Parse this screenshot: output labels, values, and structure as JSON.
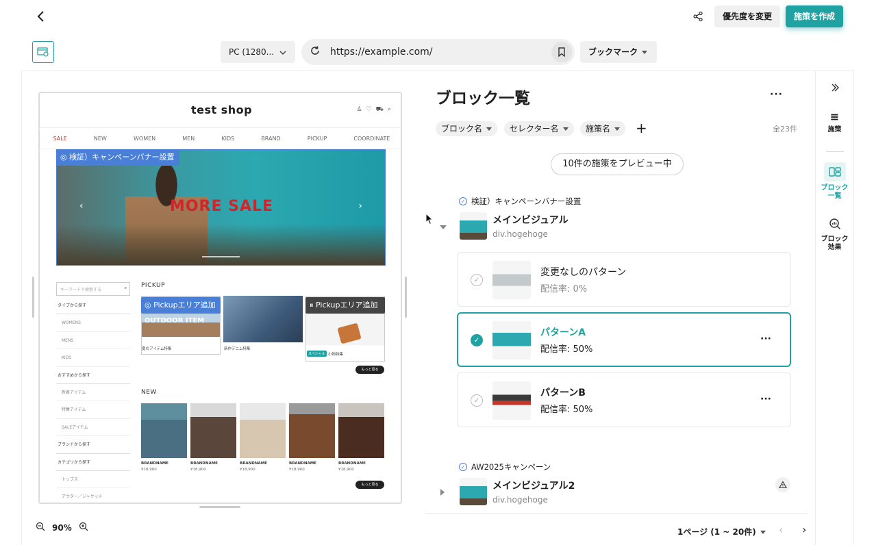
{
  "header": {
    "priority_button": "優先度を変更",
    "create_button": "施策を作成"
  },
  "toolbar": {
    "device": "PC (1280...",
    "url": "https://example.com/",
    "bookmark": "ブックマーク"
  },
  "preview": {
    "shop_title": "test shop",
    "nav": [
      "SALE",
      "NEW",
      "WOMEN",
      "MEN",
      "KIDS",
      "BRAND",
      "PICKUP",
      "COORDINATE"
    ],
    "hero_badge": "検証）キャンペーンバナー設置",
    "hero_text": "MORE SALE",
    "side_search_placeholder": "キーワードで検索する",
    "side_rows": [
      {
        "label": "タイプから探す",
        "sub": false
      },
      {
        "label": "WOMENS",
        "sub": true
      },
      {
        "label": "MENS",
        "sub": true
      },
      {
        "label": "KIDS",
        "sub": true
      },
      {
        "label": "おすすめから探す",
        "sub": false
      },
      {
        "label": "新着アイテム",
        "sub": true
      },
      {
        "label": "特集アイテム",
        "sub": true
      },
      {
        "label": "SALEアイテム",
        "sub": true
      },
      {
        "label": "ブランドから探す",
        "sub": false
      },
      {
        "label": "カテゴリから探す",
        "sub": false
      },
      {
        "label": "トップス",
        "sub": true
      },
      {
        "label": "アウター／ジャケット",
        "sub": true
      }
    ],
    "pickup_label": "PICKUP",
    "pickup_badge_1": "Pickupエリア追加",
    "pickup_badge_2": "Pickupエリア追加",
    "outdoor_text": "OUTDOOR ITEM",
    "pickup_caps": [
      "夏のアイテム特集",
      "新作デニム特集",
      "小物特集"
    ],
    "special_tag": "スペシャル",
    "more_label": "もっと見る",
    "new_label": "NEW",
    "products": [
      {
        "name": "BRANDNAME",
        "price": "¥18,900"
      },
      {
        "name": "BRANDNAME",
        "price": "¥18,900"
      },
      {
        "name": "BRANDNAME",
        "price": "¥18,900"
      },
      {
        "name": "BRANDNAME",
        "price": "¥18,900"
      },
      {
        "name": "BRANDNAME",
        "price": "¥18,900"
      }
    ],
    "zoom": "90%"
  },
  "panel": {
    "title": "ブロック一覧",
    "filters": [
      "ブロック名",
      "セレクター名",
      "施策名"
    ],
    "total": "全23件",
    "preview_pill": "10件の施策をプレビュー中",
    "block1": {
      "campaign": "検証）キャンペーンバナー設置",
      "title": "メインビジュアル",
      "selector": "div.hogehoge",
      "patterns": [
        {
          "name": "変更なしのパターン",
          "rate": "配信率: 0%"
        },
        {
          "name": "パターンA",
          "rate": "配信率: 50%"
        },
        {
          "name": "パターンB",
          "rate": "配信率: 50%"
        }
      ]
    },
    "block2": {
      "campaign": "AW2025キャンペーン",
      "title": "メインビジュアル2",
      "selector": "div.hogehoge"
    },
    "pager": "1ページ (1 ~ 20件)"
  },
  "right_sidebar": {
    "items": [
      "施策",
      "ブロック一覧",
      "ブロック効果"
    ]
  },
  "colors": {
    "accent": "#20a2a2",
    "badge_blue": "#4a7fd8"
  }
}
